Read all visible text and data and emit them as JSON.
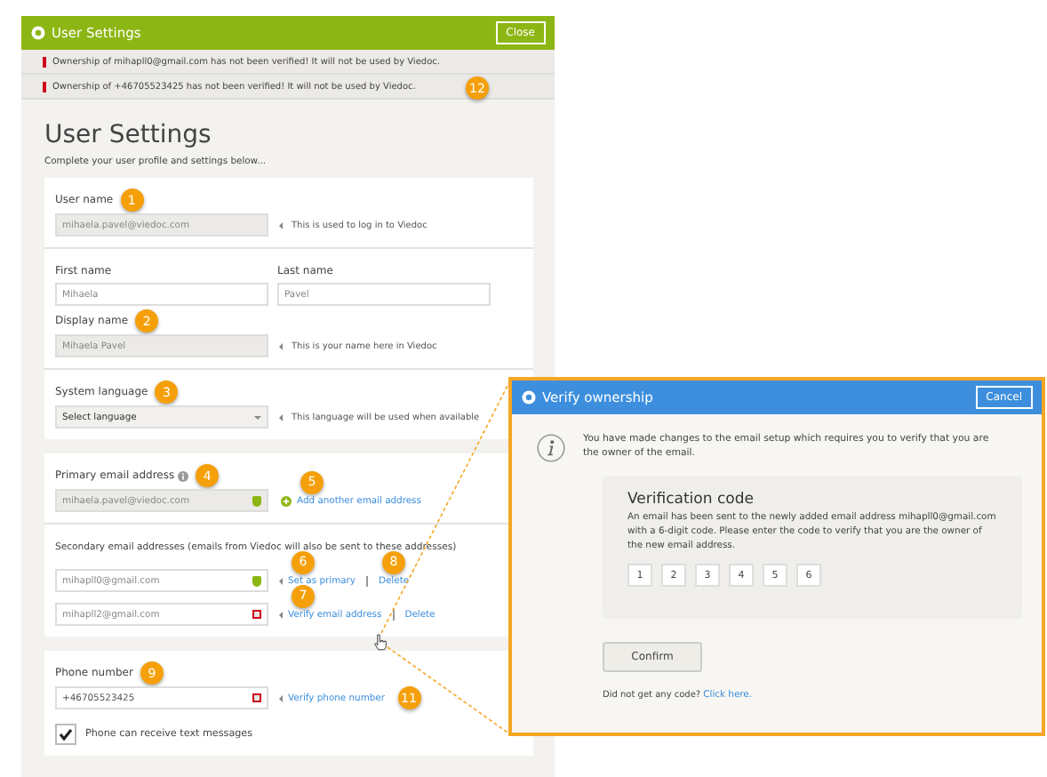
{
  "window": {
    "title": "User Settings",
    "close_button": "Close"
  },
  "warnings": [
    {
      "text": "Ownership of mihapll0@gmail.com has not been verified! It will not be used by Viedoc."
    },
    {
      "text": "Ownership of +46705523425 has not been verified! It will not be used by Viedoc."
    }
  ],
  "warnings_badge": "12",
  "heading": "User Settings",
  "subtitle": "Complete your user profile and settings below...",
  "username": {
    "label": "User name",
    "badge": "1",
    "value": "mihaela.pavel@viedoc.com",
    "hint": "This is used to log in to Viedoc"
  },
  "first_name": {
    "label": "First name",
    "value": "Mihaela"
  },
  "last_name": {
    "label": "Last name",
    "value": "Pavel"
  },
  "display_name": {
    "label": "Display name",
    "badge": "2",
    "value": "Mihaela Pavel",
    "hint": "This is your name here in Viedoc"
  },
  "language": {
    "label": "System language",
    "badge": "3",
    "value": "Select language",
    "hint": "This language will be used when available"
  },
  "primary_email": {
    "label": "Primary email address",
    "badge": "4",
    "value": "mihaela.pavel@viedoc.com",
    "verified": true,
    "add_link": "Add another email address",
    "add_badge": "5"
  },
  "secondary_emails": {
    "label": "Secondary email addresses (emails from Viedoc will also be sent to these addresses)",
    "items": [
      {
        "value": "mihapll0@gmail.com",
        "verified": true,
        "action": "Set as primary",
        "action_badge": "6",
        "delete": "Delete",
        "delete_badge": "8"
      },
      {
        "value": "mihapll2@gmail.com",
        "verified": false,
        "action": "Verify email address",
        "action_badge": "7",
        "delete": "Delete"
      }
    ]
  },
  "phone": {
    "label": "Phone number",
    "badge": "9",
    "value": "+46705523425",
    "verified": false,
    "action": "Verify phone number",
    "action_badge": "11",
    "sms_label": "Phone can receive text messages",
    "sms_checked": true
  },
  "modal": {
    "title": "Verify ownership",
    "cancel_button": "Cancel",
    "message": "You have made changes to the email setup which requires you to verify that you are the owner of the email.",
    "code_heading": "Verification code",
    "code_text": "An email has been sent to the newly added email address mihapll0@gmail.com with a 6-digit code. Please enter the code to verify that you are the owner of the new email address.",
    "digits": [
      "1",
      "2",
      "3",
      "4",
      "5",
      "6"
    ],
    "confirm_button": "Confirm",
    "footer": "Did not get any code?",
    "footer_link": "Click here."
  }
}
